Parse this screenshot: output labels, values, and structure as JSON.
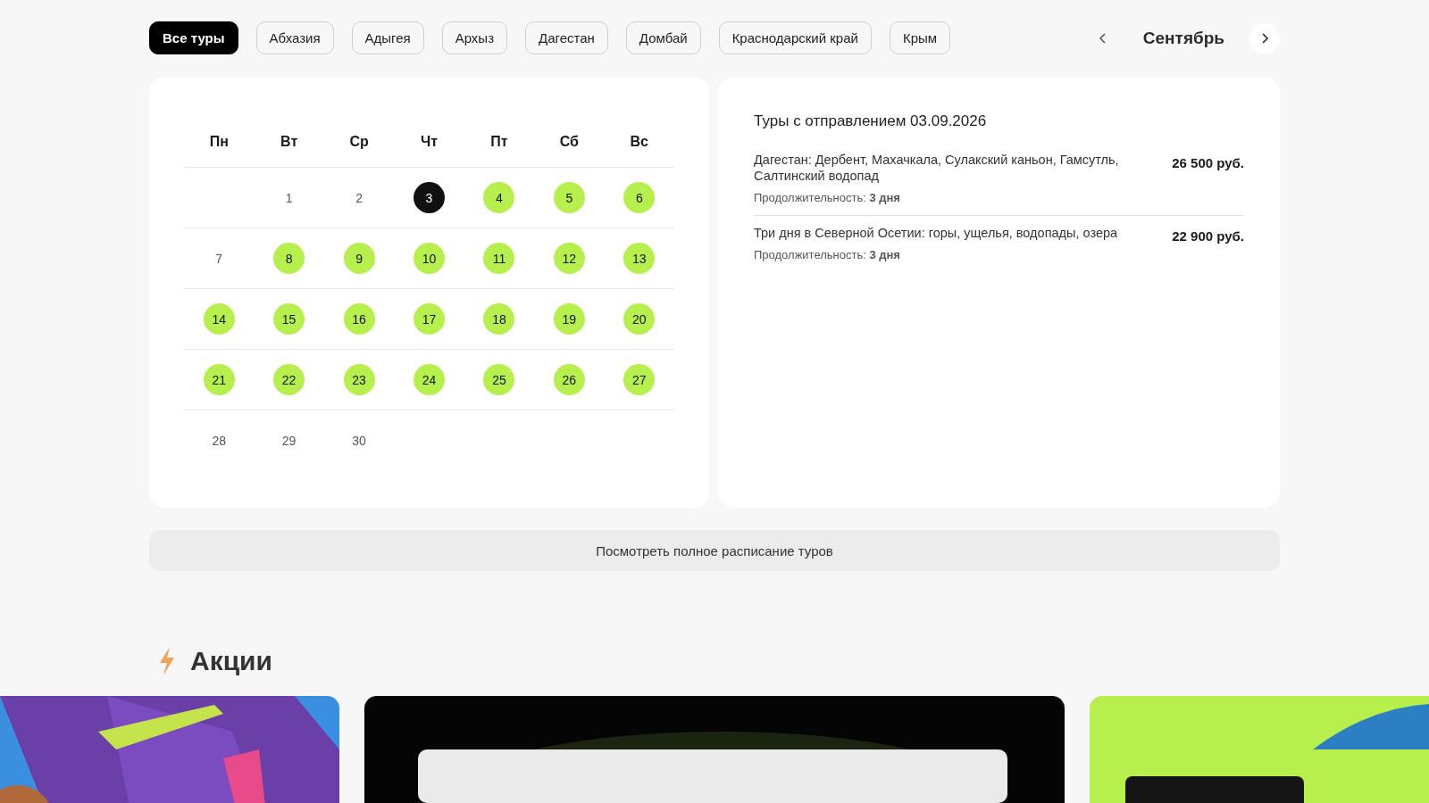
{
  "filters": [
    {
      "label": "Все туры",
      "selected": true
    },
    {
      "label": "Абхазия",
      "selected": false
    },
    {
      "label": "Адыгея",
      "selected": false
    },
    {
      "label": "Архыз",
      "selected": false
    },
    {
      "label": "Дагестан",
      "selected": false
    },
    {
      "label": "Домбай",
      "selected": false
    },
    {
      "label": "Краснодарский край",
      "selected": false
    },
    {
      "label": "Крым",
      "selected": false
    }
  ],
  "month": {
    "label": "Сентябрь"
  },
  "calendar": {
    "weekdays": [
      "Пн",
      "Вт",
      "Ср",
      "Чт",
      "Пт",
      "Сб",
      "Вс"
    ],
    "weeks": [
      [
        {
          "label": "1",
          "available": false,
          "selected": false
        },
        {
          "label": "2",
          "available": false,
          "selected": false
        },
        {
          "label": "3",
          "available": true,
          "selected": true
        },
        {
          "label": "4",
          "available": true,
          "selected": false
        },
        {
          "label": "5",
          "available": true,
          "selected": false
        },
        {
          "label": "6",
          "available": true,
          "selected": false
        }
      ],
      [
        {
          "label": "7",
          "available": false,
          "selected": false
        },
        {
          "label": "8",
          "available": true,
          "selected": false
        },
        {
          "label": "9",
          "available": true,
          "selected": false
        },
        {
          "label": "10",
          "available": true,
          "selected": false
        },
        {
          "label": "11",
          "available": true,
          "selected": false
        },
        {
          "label": "12",
          "available": true,
          "selected": false
        },
        {
          "label": "13",
          "available": true,
          "selected": false
        }
      ],
      [
        {
          "label": "14",
          "available": true,
          "selected": false
        },
        {
          "label": "15",
          "available": true,
          "selected": false
        },
        {
          "label": "16",
          "available": true,
          "selected": false
        },
        {
          "label": "17",
          "available": true,
          "selected": false
        },
        {
          "label": "18",
          "available": true,
          "selected": false
        },
        {
          "label": "19",
          "available": true,
          "selected": false
        },
        {
          "label": "20",
          "available": true,
          "selected": false
        }
      ],
      [
        {
          "label": "21",
          "available": true,
          "selected": false
        },
        {
          "label": "22",
          "available": true,
          "selected": false
        },
        {
          "label": "23",
          "available": true,
          "selected": false
        },
        {
          "label": "24",
          "available": true,
          "selected": false
        },
        {
          "label": "25",
          "available": true,
          "selected": false
        },
        {
          "label": "26",
          "available": true,
          "selected": false
        },
        {
          "label": "27",
          "available": true,
          "selected": false
        }
      ],
      [
        {
          "label": "28",
          "available": false,
          "selected": false
        },
        {
          "label": "29",
          "available": false,
          "selected": false
        },
        {
          "label": "30",
          "available": false,
          "selected": false
        }
      ]
    ]
  },
  "tours": {
    "title": "Туры с отправлением 03.09.2026",
    "items": [
      {
        "name": "Дагестан: Дербент, Махачкала, Сулакский каньон, Гамсутль, Салтинский водопад",
        "duration": "Продолжительность: **3 дня**",
        "price": "26 500 руб."
      },
      {
        "name": "Три дня в Северной Осетии: горы, ущелья, водопады, озера",
        "duration": "Продолжительность: **3 дня**",
        "price": "22 900 руб."
      }
    ]
  },
  "schedule_button": "Посмотреть полное расписание туров",
  "promos": {
    "title": "Акции"
  }
}
